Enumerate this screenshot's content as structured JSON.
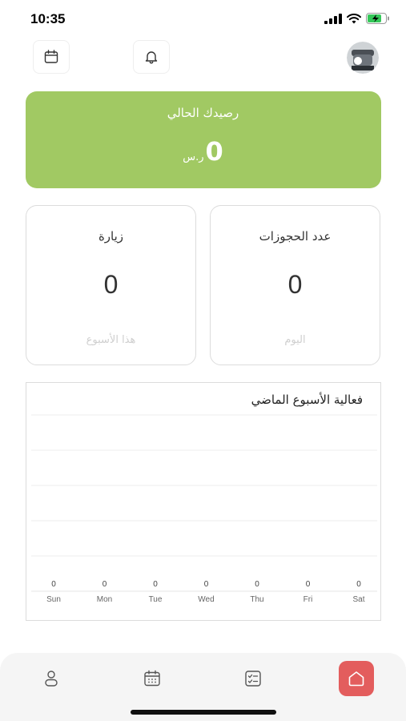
{
  "status_bar": {
    "time": "10:35"
  },
  "header": {
    "icons": [
      "calendar-icon",
      "bell-icon",
      "user-avatar"
    ]
  },
  "balance": {
    "title": "رصيدك الحالي",
    "value": "0",
    "currency": "ر.س",
    "color": "#a1c963"
  },
  "stats": [
    {
      "title": "عدد الحجوزات",
      "value": "0",
      "period": "اليوم"
    },
    {
      "title": "زيارة",
      "value": "0",
      "period": "هذا الأسبوع"
    }
  ],
  "chart_data": {
    "type": "bar",
    "title": "فعالية الأسبوع الماضي",
    "categories": [
      "Sun",
      "Mon",
      "Tue",
      "Wed",
      "Thu",
      "Fri",
      "Sat"
    ],
    "values": [
      0,
      0,
      0,
      0,
      0,
      0,
      0
    ],
    "grid": true
  },
  "tab_bar": {
    "tabs": [
      "profile-icon",
      "calendar-icon",
      "checklist-icon",
      "home-icon"
    ],
    "active": "home-icon",
    "active_color": "#e35d5d"
  }
}
